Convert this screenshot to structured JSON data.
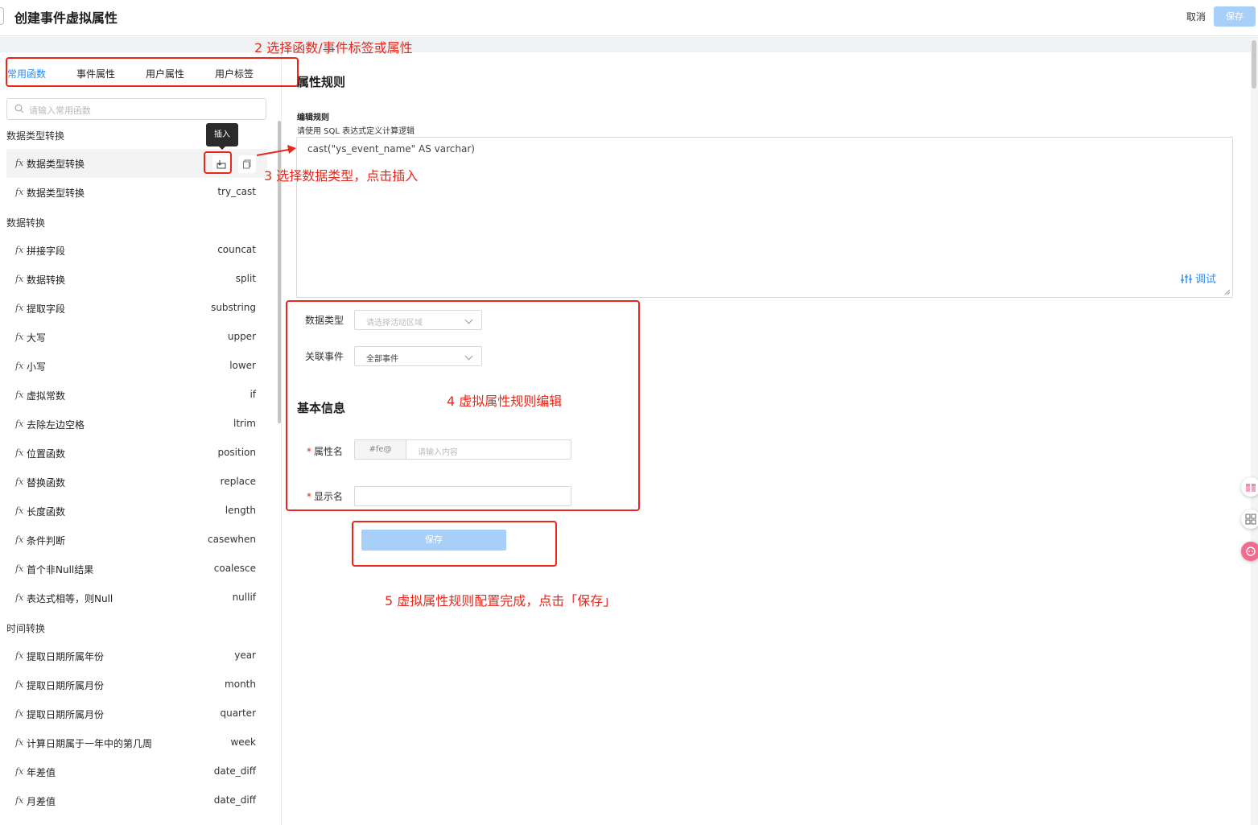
{
  "header": {
    "title": "创建事件虚拟属性",
    "cancel_label": "取消",
    "save_label": "保存"
  },
  "annotations": {
    "step2": "2 选择函数/事件标签或属性",
    "step3": "3 选择数据类型，点击插入",
    "step4": "4 虚拟属性规则编辑",
    "step5": "5 虚拟属性规则配置完成，点击「保存」"
  },
  "left": {
    "tabs": [
      "常用函数",
      "事件属性",
      "用户属性",
      "用户标签"
    ],
    "search_placeholder": "请输入常用函数",
    "tooltip": "插入",
    "categories": [
      {
        "title": "数据类型转换",
        "items": [
          {
            "name": "数据类型转换",
            "fn": ""
          },
          {
            "name": "数据类型转换",
            "fn": "try_cast"
          }
        ]
      },
      {
        "title": "数据转换",
        "items": [
          {
            "name": "拼接字段",
            "fn": "councat"
          },
          {
            "name": "数据转换",
            "fn": "split"
          },
          {
            "name": "提取字段",
            "fn": "substring"
          },
          {
            "name": "大写",
            "fn": "upper"
          },
          {
            "name": "小写",
            "fn": "lower"
          },
          {
            "name": "虚拟常数",
            "fn": "if"
          },
          {
            "name": "去除左边空格",
            "fn": "ltrim"
          },
          {
            "name": "位置函数",
            "fn": "position"
          },
          {
            "name": "替换函数",
            "fn": "replace"
          },
          {
            "name": "长度函数",
            "fn": "length"
          },
          {
            "name": "条件判断",
            "fn": "casewhen"
          },
          {
            "name": "首个非Null结果",
            "fn": "coalesce"
          },
          {
            "name": "表达式相等，则Null",
            "fn": "nullif"
          }
        ]
      },
      {
        "title": "时间转换",
        "items": [
          {
            "name": "提取日期所属年份",
            "fn": "year"
          },
          {
            "name": "提取日期所属月份",
            "fn": "month"
          },
          {
            "name": "提取日期所属月份",
            "fn": "quarter"
          },
          {
            "name": "计算日期属于一年中的第几周",
            "fn": "week"
          },
          {
            "name": "年差值",
            "fn": "date_diff"
          },
          {
            "name": "月差值",
            "fn": "date_diff"
          }
        ]
      }
    ]
  },
  "rules": {
    "title": "属性规则",
    "edit_label": "编辑规则",
    "edit_hint": "请使用 SQL 表达式定义计算逻辑",
    "code": "cast(\"ys_event_name\" AS varchar)",
    "debug_label": "调试",
    "data_type_label": "数据类型",
    "data_type_placeholder": "请选择活动区域",
    "event_label": "关联事件",
    "event_value": "全部事件"
  },
  "basic": {
    "title": "基本信息",
    "attr_label": "属性名",
    "attr_prefix": "#fe@",
    "attr_placeholder": "请输入内容",
    "display_label": "显示名",
    "save_label": "保存"
  },
  "colors": {
    "accent": "#2c8cf4",
    "annotation": "#e8281c",
    "button_disabled": "#a8cff7"
  }
}
